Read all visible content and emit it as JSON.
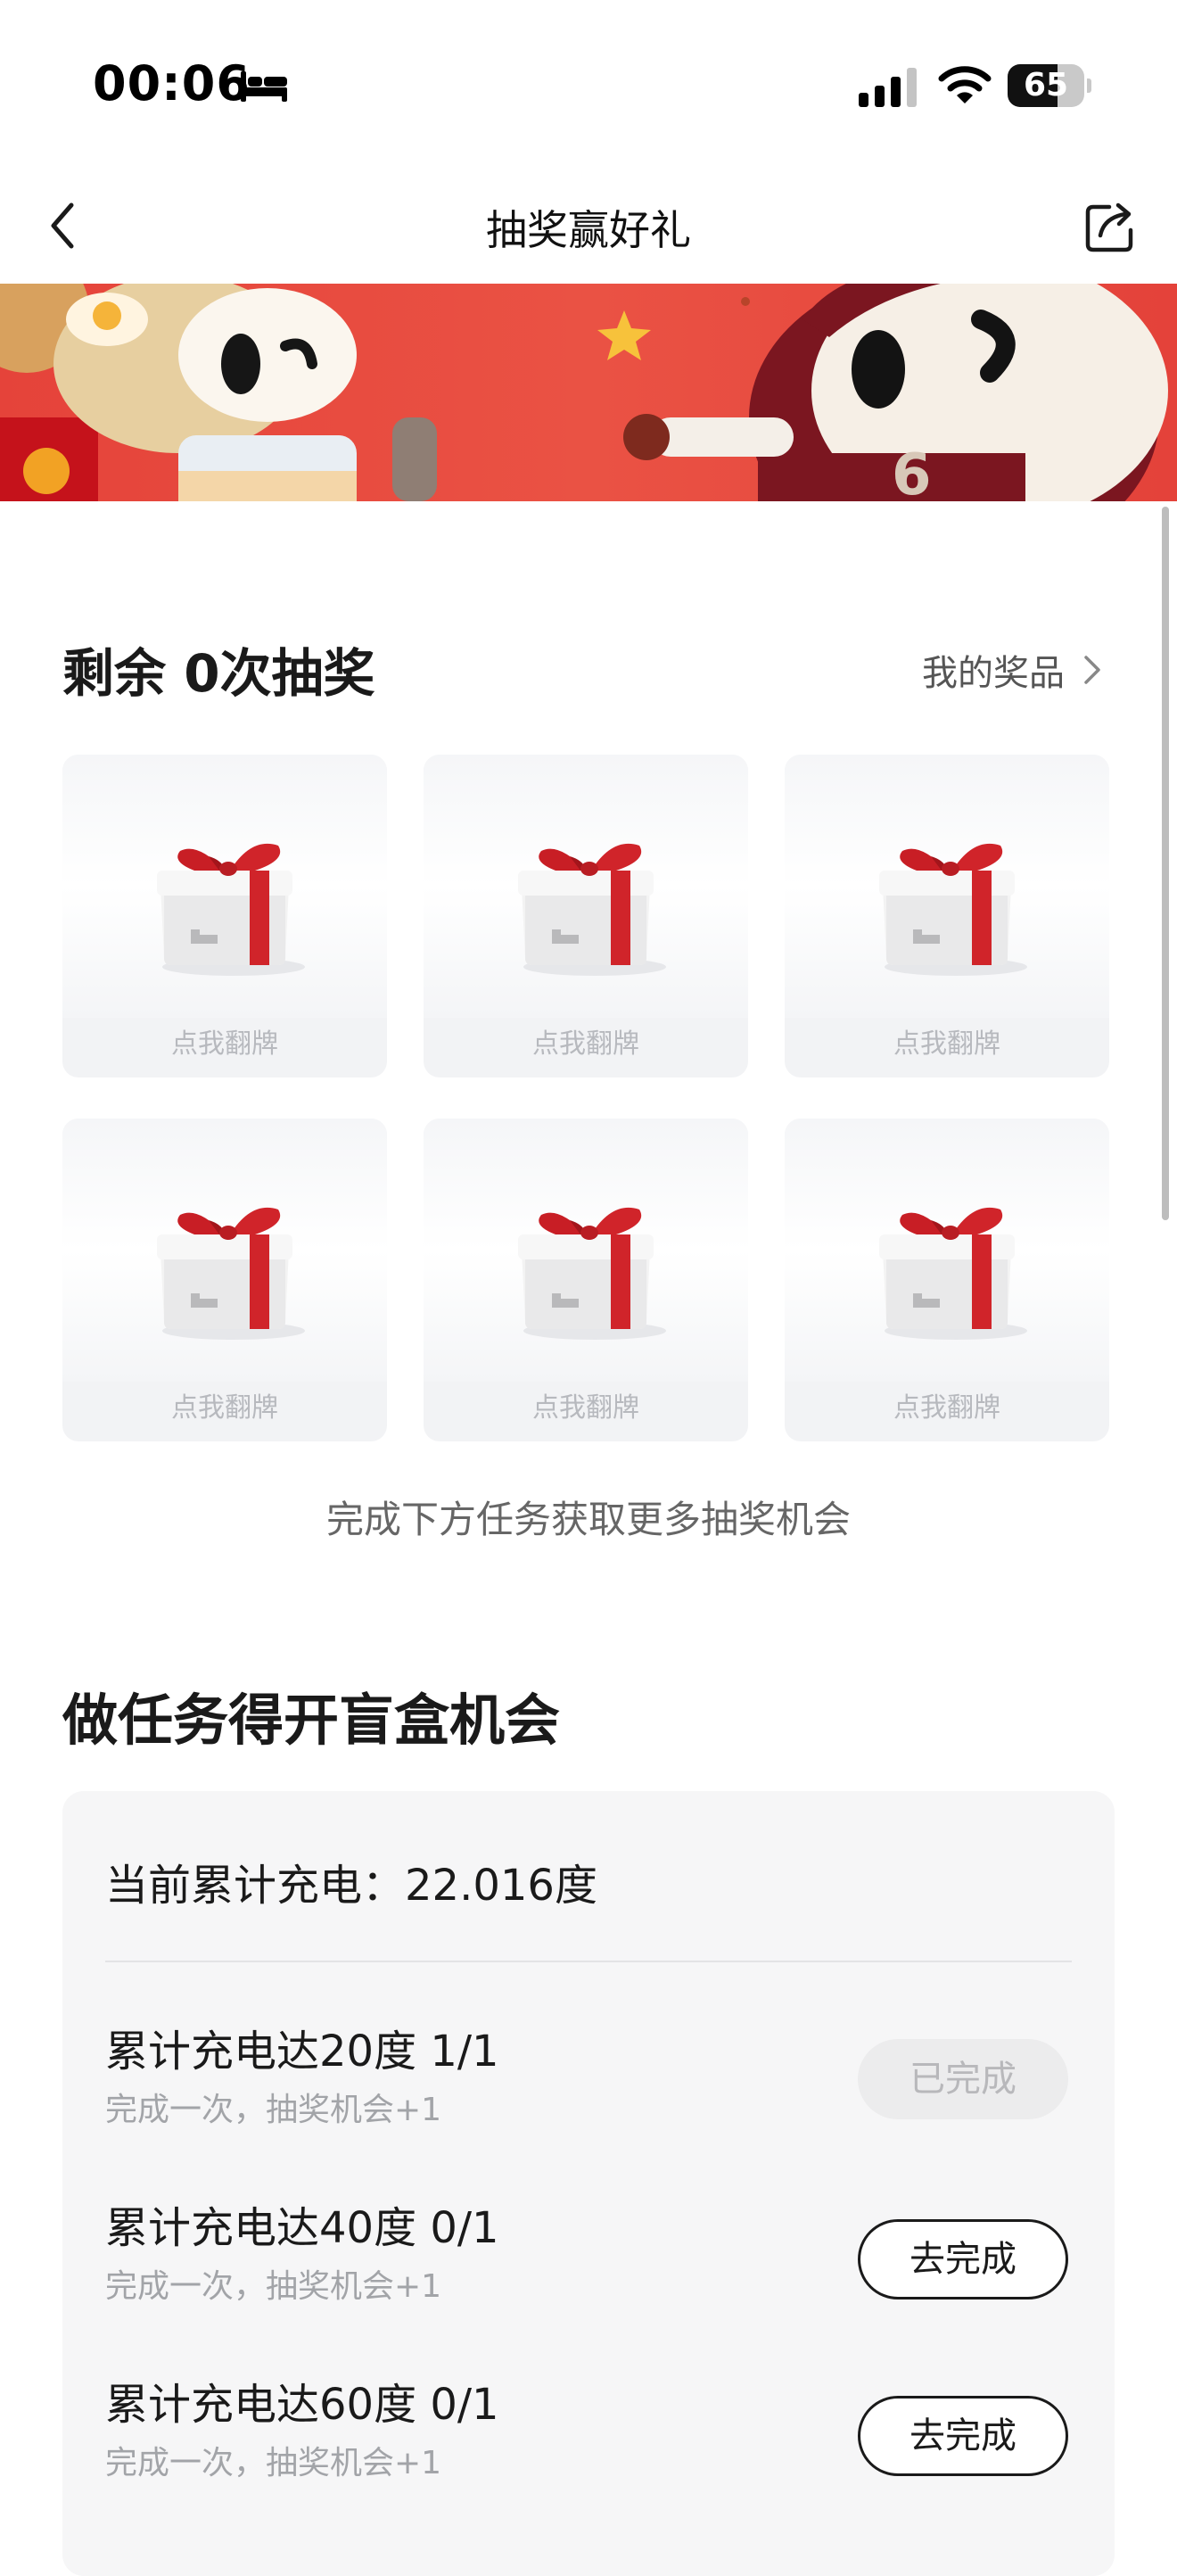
{
  "status_bar": {
    "time": "00:06",
    "battery": "65",
    "battery_level": 0.65
  },
  "nav": {
    "title": "抽奖赢好礼"
  },
  "lottery": {
    "remaining_title": "剩余 0次抽奖",
    "my_prizes_label": "我的奖品",
    "cards": [
      {
        "label": "点我翻牌"
      },
      {
        "label": "点我翻牌"
      },
      {
        "label": "点我翻牌"
      },
      {
        "label": "点我翻牌"
      },
      {
        "label": "点我翻牌"
      },
      {
        "label": "点我翻牌"
      }
    ],
    "tip": "完成下方任务获取更多抽奖机会"
  },
  "tasks": {
    "title": "做任务得开盲盒机会",
    "charge_total": "当前累计充电：22.016度",
    "items": [
      {
        "title": "累计充电达20度 1/1",
        "subtitle": "完成一次，抽奖机会+1",
        "button": "已完成"
      },
      {
        "title": "累计充电达40度 0/1",
        "subtitle": "完成一次，抽奖机会+1",
        "button": "去完成"
      },
      {
        "title": "累计充电达60度 0/1",
        "subtitle": "完成一次，抽奖机会+1",
        "button": "去完成"
      }
    ]
  },
  "colors": {
    "banner": "#e8473c",
    "ribbon": "#d0242a",
    "done_button": "#ececed"
  }
}
